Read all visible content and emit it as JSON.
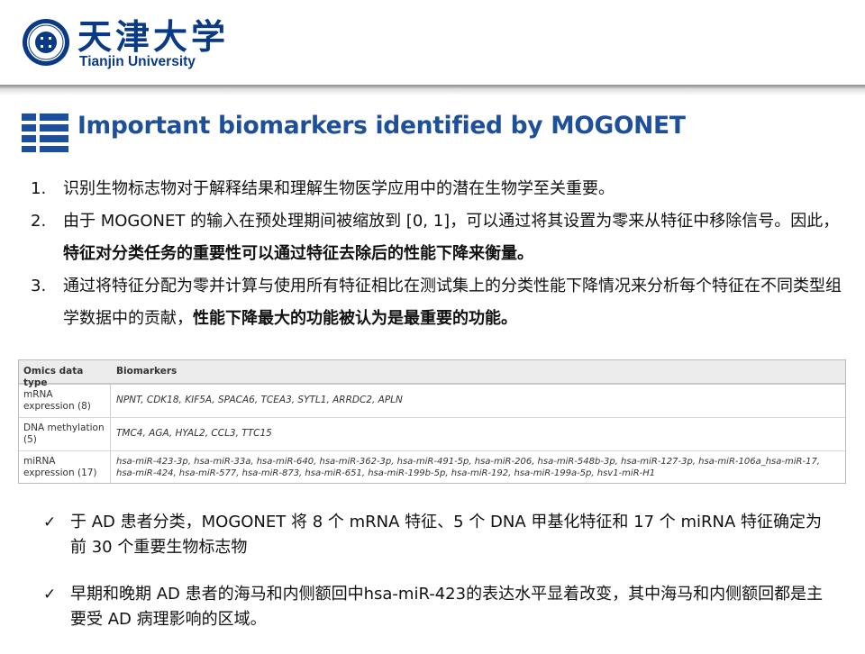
{
  "header": {
    "logo_cn": "天津大学",
    "logo_en": "Tianjin University",
    "brand_color": "#0a3a86"
  },
  "slide": {
    "title": "Important biomarkers identified by MOGONET",
    "title_color": "#1d4f9a"
  },
  "numbered": [
    {
      "num": "1.",
      "text": "识别生物标志物对于解释结果和理解生物医学应用中的潜在生物学至关重要。",
      "bold": ""
    },
    {
      "num": "2.",
      "text": "由于 MOGONET 的输入在预处理期间被缩放到 [0, 1]，可以通过将其设置为零来从特征中移除信号。因此，",
      "bold": "特征对分类任务的重要性可以通过特征去除后的性能下降来衡量。"
    },
    {
      "num": "3.",
      "text": "通过将特征分配为零并计算与使用所有特征相比在测试集上的分类性能下降情况来分析每个特征在不同类型组学数据中的贡献，",
      "bold": "性能下降最大的功能被认为是最重要的功能。"
    }
  ],
  "table": {
    "headers": [
      "Omics data type",
      "Biomarkers"
    ],
    "rows": [
      {
        "type": "mRNA expression (8)",
        "markers": "NPNT, CDK18, KIF5A, SPACA6, TCEA3, SYTL1, ARRDC2, APLN"
      },
      {
        "type": "DNA methylation (5)",
        "markers": "TMC4, AGA, HYAL2, CCL3, TTC15"
      },
      {
        "type": "miRNA expression (17)",
        "markers": "hsa-miR-423-3p, hsa-miR-33a, hsa-miR-640, hsa-miR-362-3p, hsa-miR-491-5p, hsa-miR-206, hsa-miR-548b-3p, hsa-miR-127-3p, hsa-miR-106a_hsa-miR-17, hsa-miR-424, hsa-miR-577, hsa-miR-873, hsa-miR-651, hsa-miR-199b-5p, hsa-miR-192, hsa-miR-199a-5p, hsv1-miR-H1"
      }
    ]
  },
  "checks": [
    {
      "mark": "✓",
      "text": "于 AD 患者分类，MOGONET 将 8 个 mRNA 特征、5 个 DNA 甲基化特征和 17 个 miRNA 特征确定为前 30 个重要生物标志物"
    },
    {
      "mark": "✓",
      "text": "早期和晚期 AD 患者的海马和内侧额回中hsa-miR-423的表达水平显着改变，其中海马和内侧额回都是主要受 AD 病理影响的区域。"
    }
  ]
}
